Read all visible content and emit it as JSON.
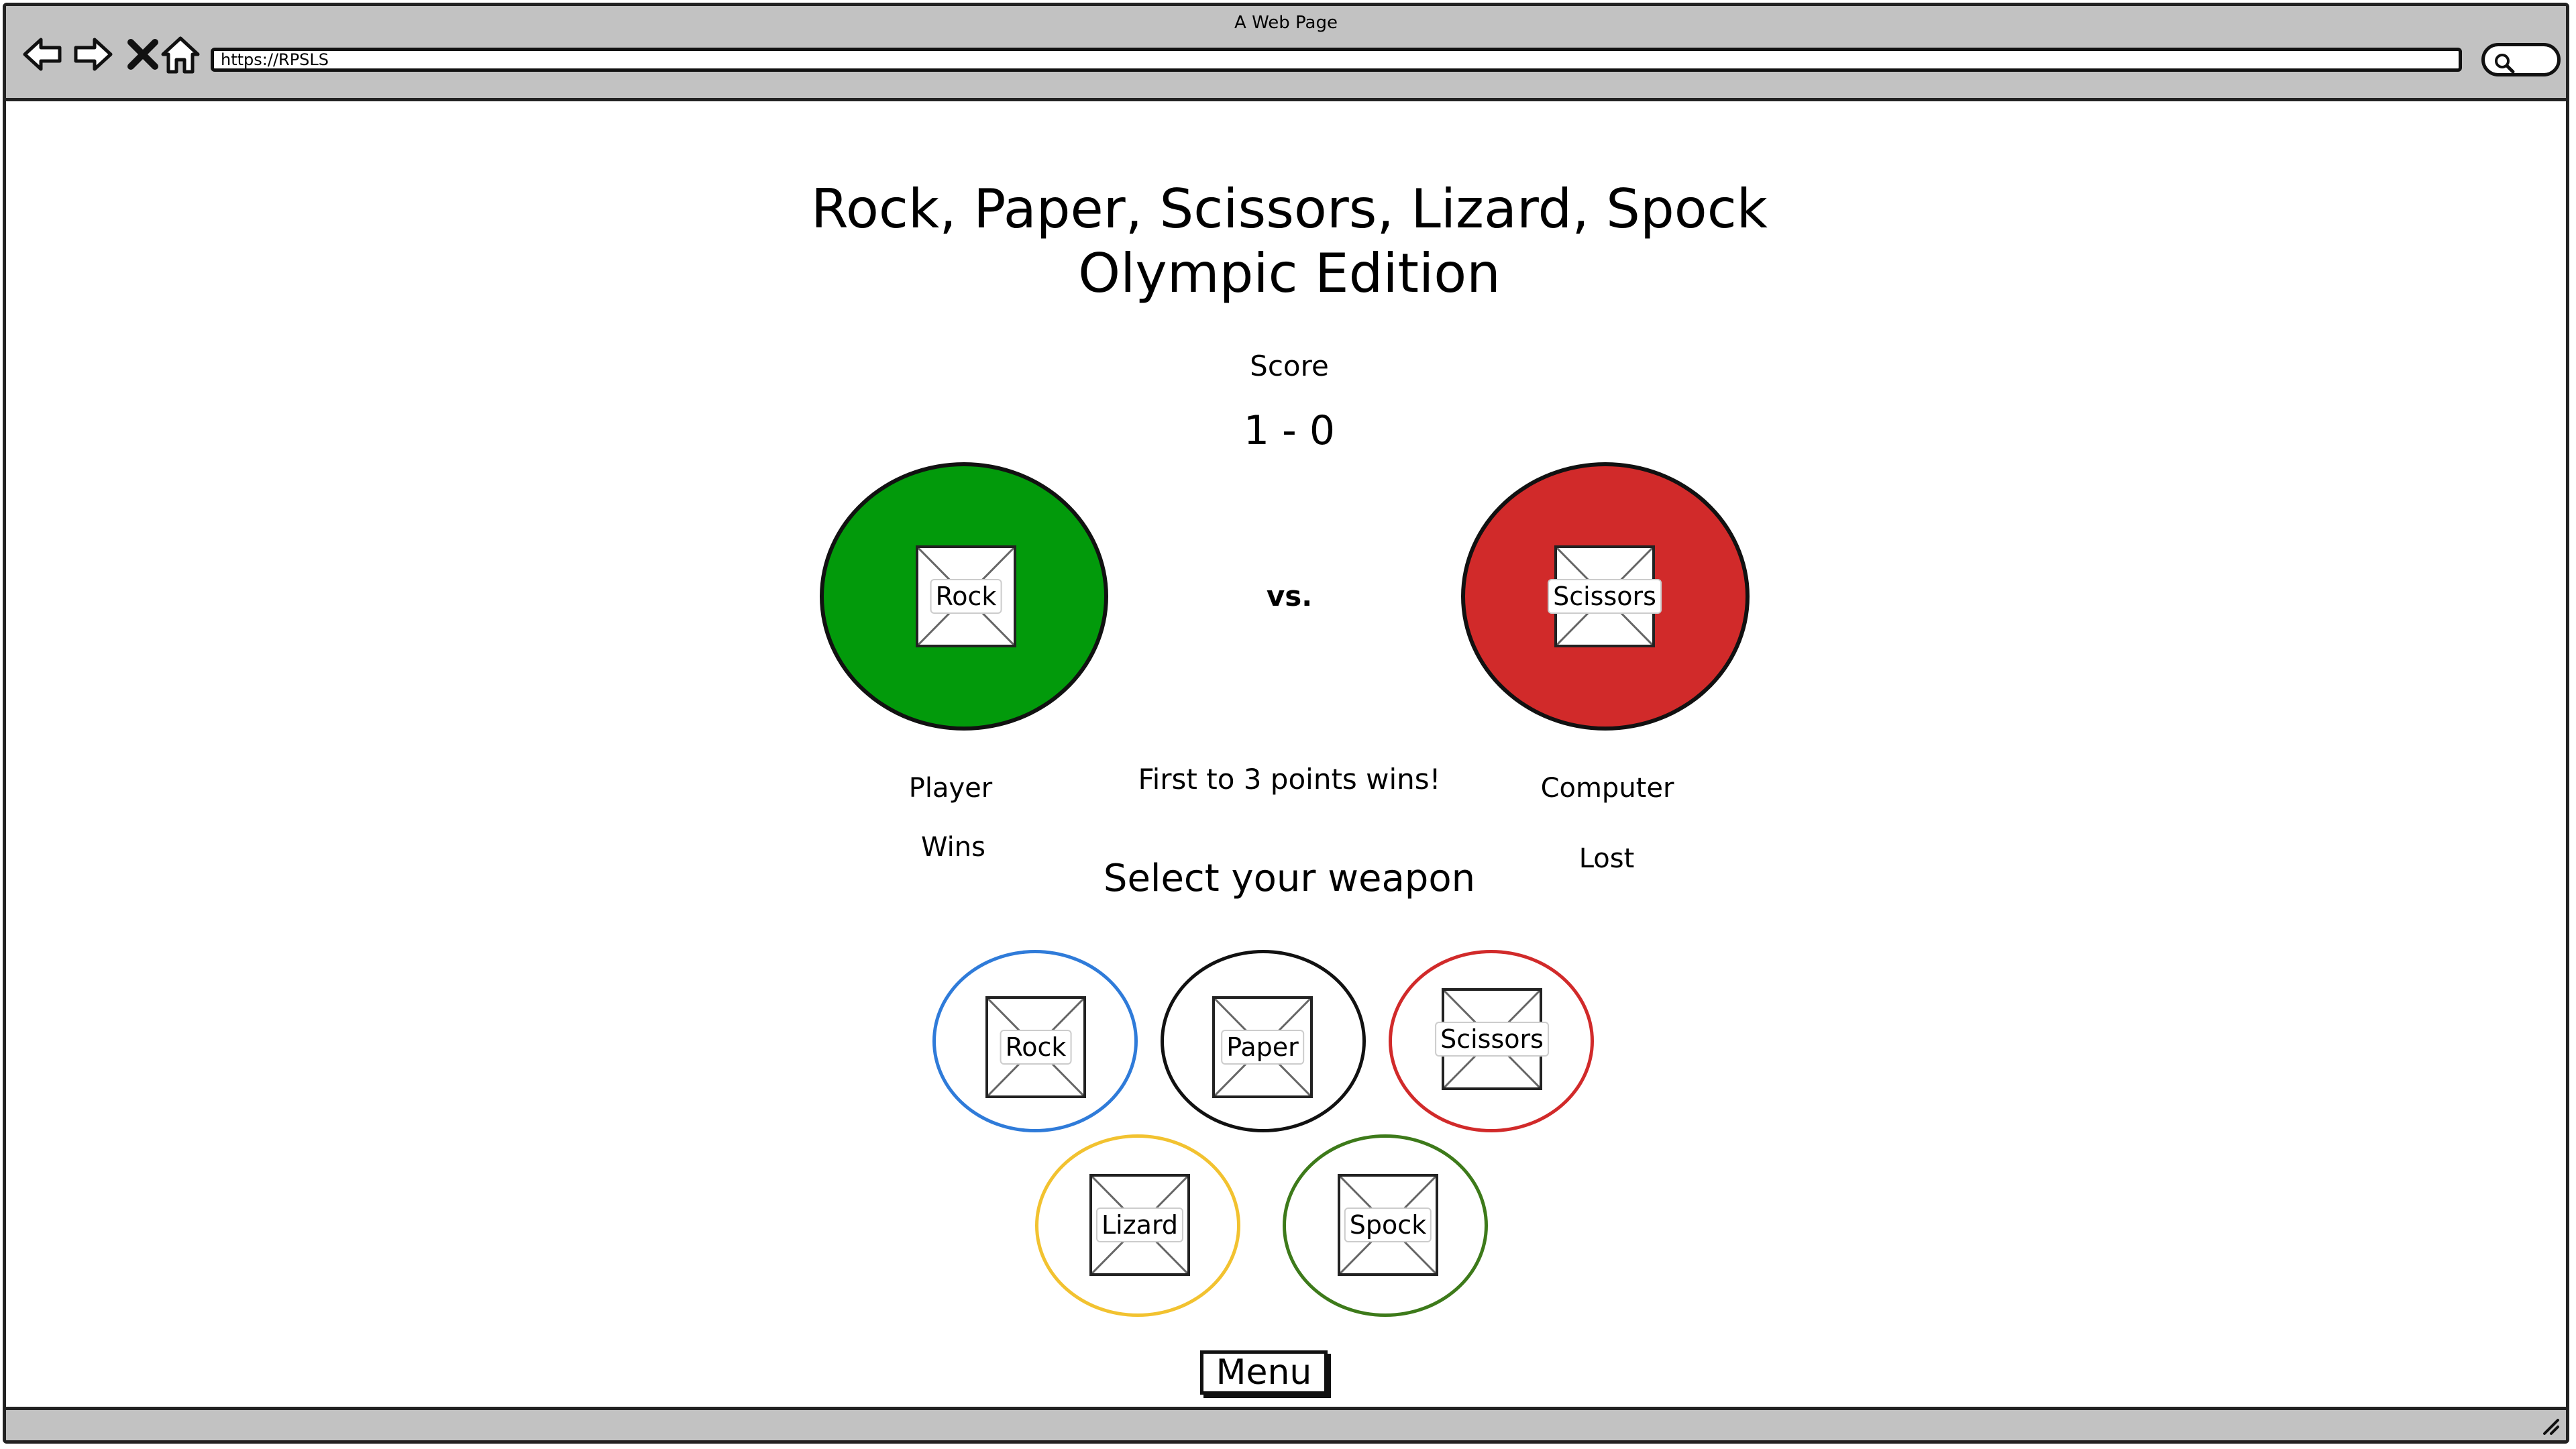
{
  "browser": {
    "window_title": "A Web Page",
    "url": "https://RPSLS",
    "icons": [
      "back-icon",
      "forward-icon",
      "close-icon",
      "home-icon",
      "search-icon",
      "resize-icon"
    ]
  },
  "game": {
    "title_line1": "Rock, Paper, Scissors, Lizard, Spock",
    "title_line2": "Olympic Edition",
    "score_label": "Score",
    "score_value": "1 - 0",
    "vs_label": "vs.",
    "rules_text": "First to 3 points wins!",
    "player": {
      "label": "Player",
      "choice": "Rock",
      "result": "Wins",
      "color": "#029a0b"
    },
    "computer": {
      "label": "Computer",
      "choice": "Scissors",
      "result": "Lost",
      "color": "#d12a2a"
    },
    "select_heading": "Select your weapon",
    "weapons": [
      {
        "label": "Rock",
        "ring_color": "#2f7bd9"
      },
      {
        "label": "Paper",
        "ring_color": "#111111"
      },
      {
        "label": "Scissors",
        "ring_color": "#d12a2a"
      },
      {
        "label": "Lizard",
        "ring_color": "#f2c230"
      },
      {
        "label": "Spock",
        "ring_color": "#3d7a1a"
      }
    ],
    "menu_button": "Menu"
  }
}
